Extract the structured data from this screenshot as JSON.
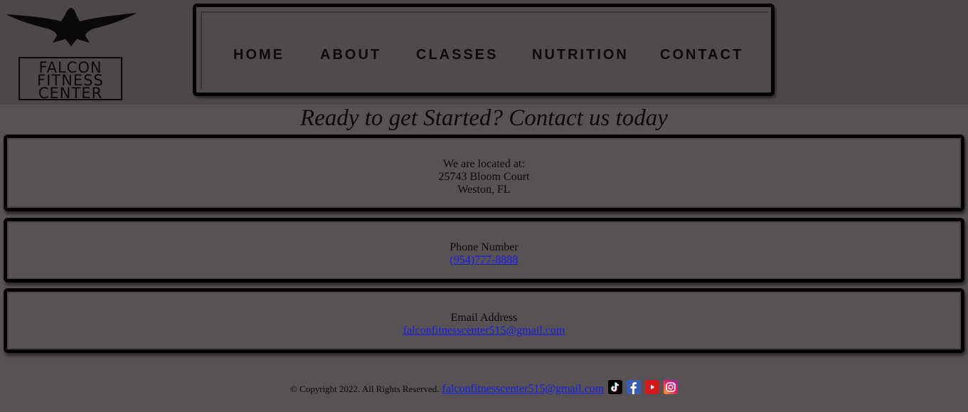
{
  "brand": {
    "logo_lines": [
      "FALCON",
      "FITNESS",
      "CENTER"
    ]
  },
  "nav": {
    "items": [
      {
        "label": "HOME"
      },
      {
        "label": "ABOUT"
      },
      {
        "label": "CLASSES"
      },
      {
        "label": "NUTRITION"
      },
      {
        "label": "CONTACT"
      }
    ]
  },
  "main": {
    "heading": "Ready to get Started? Contact us today",
    "location": {
      "label": "We are located at:",
      "street": "25743 Bloom Court",
      "city": "Weston, FL"
    },
    "phone": {
      "label": "Phone Number",
      "value": "(954)777-8888"
    },
    "email": {
      "label": "Email Address",
      "value": "falconfitnesscenter515@gmail.com"
    }
  },
  "footer": {
    "copyright": "© Copyright 2022. All Rights Reserved.",
    "email": "falconfitnesscenter515@gmail.com",
    "social_icons": [
      "tiktok-icon",
      "facebook-icon",
      "youtube-icon",
      "instagram-icon"
    ]
  },
  "colors": {
    "page_bg": "#575253",
    "header_bg": "#4c4849",
    "link": "#1a1aee",
    "border": "#000000"
  }
}
